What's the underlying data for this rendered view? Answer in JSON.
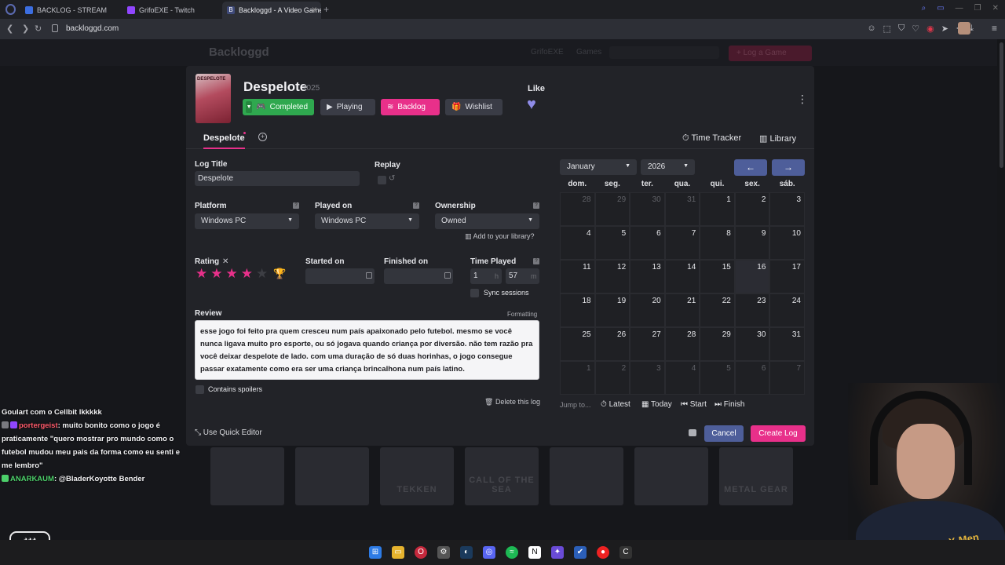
{
  "browser": {
    "tabs": [
      {
        "label": "BACKLOG - STREAM"
      },
      {
        "label": "GrifoEXE - Twitch"
      },
      {
        "label": "Backloggd - A Video Game"
      }
    ],
    "url": "backloggd.com"
  },
  "site": {
    "logo": "Backloggd",
    "user": "GrifoEXE",
    "nav_games": "Games",
    "log_button": "+ Log a Game",
    "bg_covers": [
      "",
      "",
      "TEKKEN",
      "CALL OF THE SEA",
      "",
      "",
      "METAL GEAR"
    ]
  },
  "modal": {
    "game_title": "Despelote",
    "game_year": "2025",
    "cover_text": "DESPELOTE",
    "status_buttons": {
      "completed": "Completed",
      "playing": "Playing",
      "backlog": "Backlog",
      "wishlist": "Wishlist"
    },
    "like_label": "Like",
    "tabs": {
      "log_tab": "Despelote",
      "time_tracker": "Time Tracker",
      "library": "Library"
    },
    "form": {
      "log_title_label": "Log Title",
      "log_title_value": "Despelote",
      "replay_label": "Replay",
      "platform_label": "Platform",
      "platform_value": "Windows PC",
      "played_on_label": "Played on",
      "played_on_value": "Windows PC",
      "ownership_label": "Ownership",
      "ownership_value": "Owned",
      "add_library": "Add to your library?",
      "rating_label": "Rating",
      "rating_value": 4,
      "rating_max": 5,
      "started_label": "Started on",
      "finished_label": "Finished on",
      "time_played_label": "Time Played",
      "hours_value": "1",
      "hours_unit": "h",
      "minutes_value": "57",
      "minutes_unit": "m",
      "sync_sessions": "Sync sessions",
      "review_label": "Review",
      "formatting": "Formatting",
      "review_text": "esse jogo foi feito pra quem cresceu num país apaixonado pelo futebol. mesmo se você nunca ligava muito pro esporte, ou só jogava quando criança por diversão. não tem razão pra você deixar despelote de lado. com uma duração de só duas horinhas, o jogo consegue passar exatamente como era ser uma criança brincalhona num país latino.",
      "contains_spoilers": "Contains spoilers",
      "delete_log": "Delete this log"
    },
    "calendar": {
      "month": "January",
      "year": "2026",
      "weekdays": [
        "dom.",
        "seg.",
        "ter.",
        "qua.",
        "qui.",
        "sex.",
        "sáb."
      ],
      "weeks": [
        [
          {
            "d": "28",
            "out": true
          },
          {
            "d": "29",
            "out": true
          },
          {
            "d": "30",
            "out": true
          },
          {
            "d": "31",
            "out": true
          },
          {
            "d": "1"
          },
          {
            "d": "2"
          },
          {
            "d": "3"
          }
        ],
        [
          {
            "d": "4"
          },
          {
            "d": "5"
          },
          {
            "d": "6"
          },
          {
            "d": "7"
          },
          {
            "d": "8"
          },
          {
            "d": "9"
          },
          {
            "d": "10"
          }
        ],
        [
          {
            "d": "11"
          },
          {
            "d": "12"
          },
          {
            "d": "13"
          },
          {
            "d": "14"
          },
          {
            "d": "15"
          },
          {
            "d": "16",
            "today": true
          },
          {
            "d": "17"
          }
        ],
        [
          {
            "d": "18"
          },
          {
            "d": "19"
          },
          {
            "d": "20"
          },
          {
            "d": "21"
          },
          {
            "d": "22"
          },
          {
            "d": "23"
          },
          {
            "d": "24"
          }
        ],
        [
          {
            "d": "25"
          },
          {
            "d": "26"
          },
          {
            "d": "27"
          },
          {
            "d": "28"
          },
          {
            "d": "29"
          },
          {
            "d": "30"
          },
          {
            "d": "31"
          }
        ],
        [
          {
            "d": "1",
            "out": true
          },
          {
            "d": "2",
            "out": true
          },
          {
            "d": "3",
            "out": true
          },
          {
            "d": "4",
            "out": true
          },
          {
            "d": "5",
            "out": true
          },
          {
            "d": "6",
            "out": true
          },
          {
            "d": "7",
            "out": true
          }
        ]
      ],
      "jump_to": "Jump to...",
      "jump_latest": "Latest",
      "jump_today": "Today",
      "jump_start": "Start",
      "jump_finish": "Finish"
    },
    "footer": {
      "quick_editor": "Use Quick Editor",
      "cancel": "Cancel",
      "create_log": "Create Log"
    }
  },
  "chat": [
    {
      "user": "",
      "text": "Goulart com o Cellbit lkkkkk"
    },
    {
      "user": "portergeist",
      "text": ": muito bonito como o jogo é praticamente \"quero mostrar pro mundo como o futebol mudou meu pais da forma como eu senti e me lembro\""
    },
    {
      "user": "ANARKAUM",
      "text": ": @BladerKoyotte Bender"
    }
  ],
  "webcam_shirt_text": "X-Men",
  "colors": {
    "accent_pink": "#e8308a",
    "completed_green": "#2fa84f",
    "nav_blue": "#4e5e9a",
    "modal_bg": "#222328"
  }
}
